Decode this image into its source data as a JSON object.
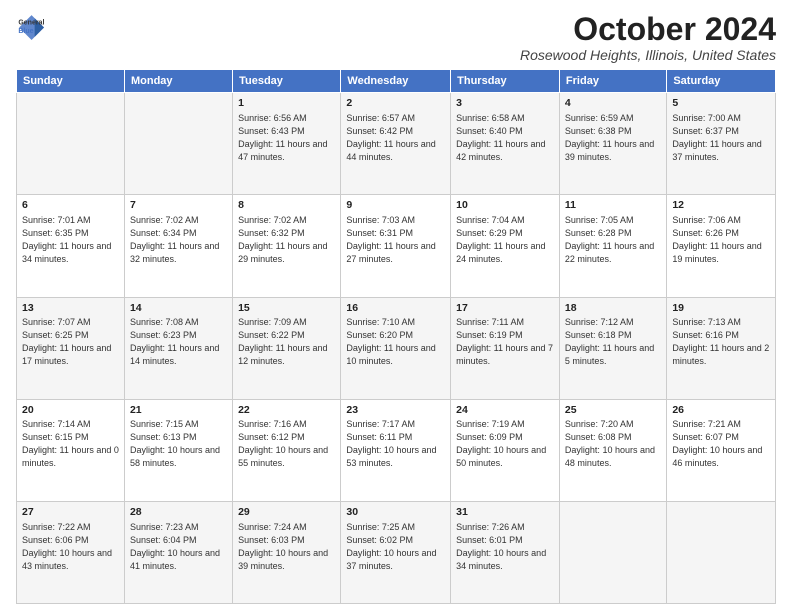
{
  "logo": {
    "line1": "General",
    "line2": "Blue"
  },
  "header": {
    "month": "October 2024",
    "location": "Rosewood Heights, Illinois, United States"
  },
  "weekdays": [
    "Sunday",
    "Monday",
    "Tuesday",
    "Wednesday",
    "Thursday",
    "Friday",
    "Saturday"
  ],
  "weeks": [
    [
      {
        "day": "",
        "info": ""
      },
      {
        "day": "",
        "info": ""
      },
      {
        "day": "1",
        "info": "Sunrise: 6:56 AM\nSunset: 6:43 PM\nDaylight: 11 hours and 47 minutes."
      },
      {
        "day": "2",
        "info": "Sunrise: 6:57 AM\nSunset: 6:42 PM\nDaylight: 11 hours and 44 minutes."
      },
      {
        "day": "3",
        "info": "Sunrise: 6:58 AM\nSunset: 6:40 PM\nDaylight: 11 hours and 42 minutes."
      },
      {
        "day": "4",
        "info": "Sunrise: 6:59 AM\nSunset: 6:38 PM\nDaylight: 11 hours and 39 minutes."
      },
      {
        "day": "5",
        "info": "Sunrise: 7:00 AM\nSunset: 6:37 PM\nDaylight: 11 hours and 37 minutes."
      }
    ],
    [
      {
        "day": "6",
        "info": "Sunrise: 7:01 AM\nSunset: 6:35 PM\nDaylight: 11 hours and 34 minutes."
      },
      {
        "day": "7",
        "info": "Sunrise: 7:02 AM\nSunset: 6:34 PM\nDaylight: 11 hours and 32 minutes."
      },
      {
        "day": "8",
        "info": "Sunrise: 7:02 AM\nSunset: 6:32 PM\nDaylight: 11 hours and 29 minutes."
      },
      {
        "day": "9",
        "info": "Sunrise: 7:03 AM\nSunset: 6:31 PM\nDaylight: 11 hours and 27 minutes."
      },
      {
        "day": "10",
        "info": "Sunrise: 7:04 AM\nSunset: 6:29 PM\nDaylight: 11 hours and 24 minutes."
      },
      {
        "day": "11",
        "info": "Sunrise: 7:05 AM\nSunset: 6:28 PM\nDaylight: 11 hours and 22 minutes."
      },
      {
        "day": "12",
        "info": "Sunrise: 7:06 AM\nSunset: 6:26 PM\nDaylight: 11 hours and 19 minutes."
      }
    ],
    [
      {
        "day": "13",
        "info": "Sunrise: 7:07 AM\nSunset: 6:25 PM\nDaylight: 11 hours and 17 minutes."
      },
      {
        "day": "14",
        "info": "Sunrise: 7:08 AM\nSunset: 6:23 PM\nDaylight: 11 hours and 14 minutes."
      },
      {
        "day": "15",
        "info": "Sunrise: 7:09 AM\nSunset: 6:22 PM\nDaylight: 11 hours and 12 minutes."
      },
      {
        "day": "16",
        "info": "Sunrise: 7:10 AM\nSunset: 6:20 PM\nDaylight: 11 hours and 10 minutes."
      },
      {
        "day": "17",
        "info": "Sunrise: 7:11 AM\nSunset: 6:19 PM\nDaylight: 11 hours and 7 minutes."
      },
      {
        "day": "18",
        "info": "Sunrise: 7:12 AM\nSunset: 6:18 PM\nDaylight: 11 hours and 5 minutes."
      },
      {
        "day": "19",
        "info": "Sunrise: 7:13 AM\nSunset: 6:16 PM\nDaylight: 11 hours and 2 minutes."
      }
    ],
    [
      {
        "day": "20",
        "info": "Sunrise: 7:14 AM\nSunset: 6:15 PM\nDaylight: 11 hours and 0 minutes."
      },
      {
        "day": "21",
        "info": "Sunrise: 7:15 AM\nSunset: 6:13 PM\nDaylight: 10 hours and 58 minutes."
      },
      {
        "day": "22",
        "info": "Sunrise: 7:16 AM\nSunset: 6:12 PM\nDaylight: 10 hours and 55 minutes."
      },
      {
        "day": "23",
        "info": "Sunrise: 7:17 AM\nSunset: 6:11 PM\nDaylight: 10 hours and 53 minutes."
      },
      {
        "day": "24",
        "info": "Sunrise: 7:19 AM\nSunset: 6:09 PM\nDaylight: 10 hours and 50 minutes."
      },
      {
        "day": "25",
        "info": "Sunrise: 7:20 AM\nSunset: 6:08 PM\nDaylight: 10 hours and 48 minutes."
      },
      {
        "day": "26",
        "info": "Sunrise: 7:21 AM\nSunset: 6:07 PM\nDaylight: 10 hours and 46 minutes."
      }
    ],
    [
      {
        "day": "27",
        "info": "Sunrise: 7:22 AM\nSunset: 6:06 PM\nDaylight: 10 hours and 43 minutes."
      },
      {
        "day": "28",
        "info": "Sunrise: 7:23 AM\nSunset: 6:04 PM\nDaylight: 10 hours and 41 minutes."
      },
      {
        "day": "29",
        "info": "Sunrise: 7:24 AM\nSunset: 6:03 PM\nDaylight: 10 hours and 39 minutes."
      },
      {
        "day": "30",
        "info": "Sunrise: 7:25 AM\nSunset: 6:02 PM\nDaylight: 10 hours and 37 minutes."
      },
      {
        "day": "31",
        "info": "Sunrise: 7:26 AM\nSunset: 6:01 PM\nDaylight: 10 hours and 34 minutes."
      },
      {
        "day": "",
        "info": ""
      },
      {
        "day": "",
        "info": ""
      }
    ]
  ]
}
